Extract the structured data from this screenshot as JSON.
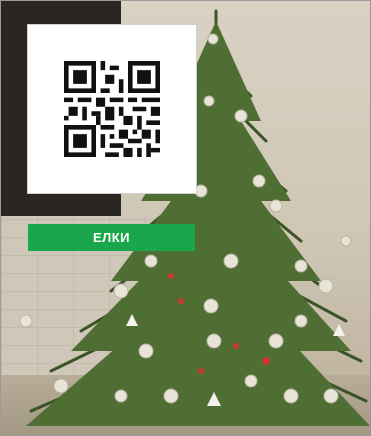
{
  "card": {
    "label": "ЕЛКИ",
    "label_color": "#1aa64a",
    "qr_icon": "qr-code-icon"
  },
  "colors": {
    "tree": "#3f5a2a",
    "ornament": "#e8e4d8",
    "tinsel": "#c93a2e"
  }
}
